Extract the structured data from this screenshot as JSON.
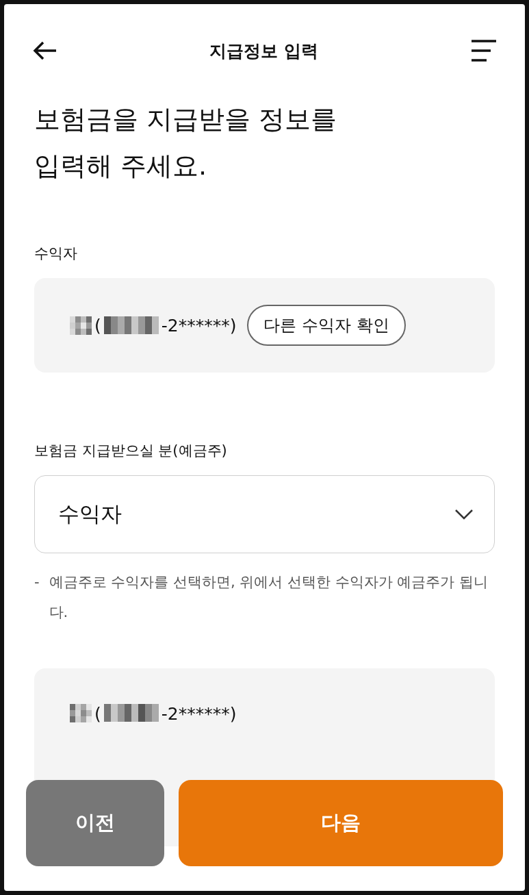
{
  "header": {
    "title": "지급정보 입력"
  },
  "heading": [
    "보험금을 지급받을 정보를",
    "입력해 주세요."
  ],
  "beneficiary": {
    "label": "수익자",
    "id_open": "(",
    "id_tail": "-2******)",
    "button": "다른 수익자 확인"
  },
  "holder": {
    "label": "보험금 지급받으실 분(예금주)",
    "value": "수익자",
    "note_dash": "-",
    "note": "예금주로 수익자를 선택하면, 위에서 선택한 수익자가 예금주가 됩니다."
  },
  "holder_card": {
    "id_open": "(",
    "id_tail": "-2******)"
  },
  "buttons": [
    {
      "label": "이전",
      "kind": "secondary"
    },
    {
      "label": "다음",
      "kind": "primary"
    }
  ]
}
